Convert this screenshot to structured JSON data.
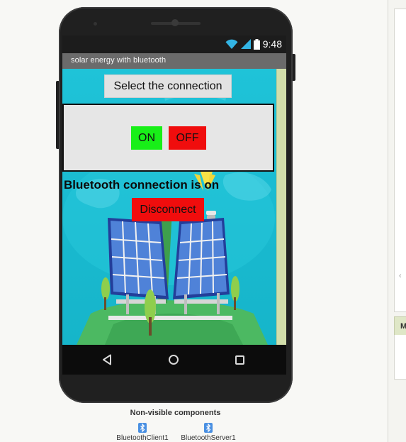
{
  "app": {
    "title": "solar energy with bluetooth"
  },
  "status_bar": {
    "time": "9:48",
    "icons": [
      "wifi-icon",
      "signal-icon",
      "battery-icon"
    ]
  },
  "screen": {
    "select_button_label": "Select the connection",
    "on_button_label": "ON",
    "off_button_label": "OFF",
    "status_text": "Bluetooth connection is on",
    "disconnect_button_label": "Disconnect"
  },
  "nav_bar": {
    "icons": [
      "back-icon",
      "home-icon",
      "recent-apps-icon"
    ]
  },
  "designer": {
    "non_visible_title": "Non-visible components",
    "components": [
      {
        "name": "BluetoothClient1",
        "icon": "bluetooth-icon"
      },
      {
        "name": "BluetoothServer1",
        "icon": "bluetooth-icon"
      }
    ],
    "right_panel_tab": "M"
  },
  "colors": {
    "on_button": "#18ef18",
    "off_button": "#f00d0d",
    "disconnect_button": "#f00d0d",
    "title_bar": "#6b6b6b",
    "scene_sky": "#1fc3d8"
  }
}
